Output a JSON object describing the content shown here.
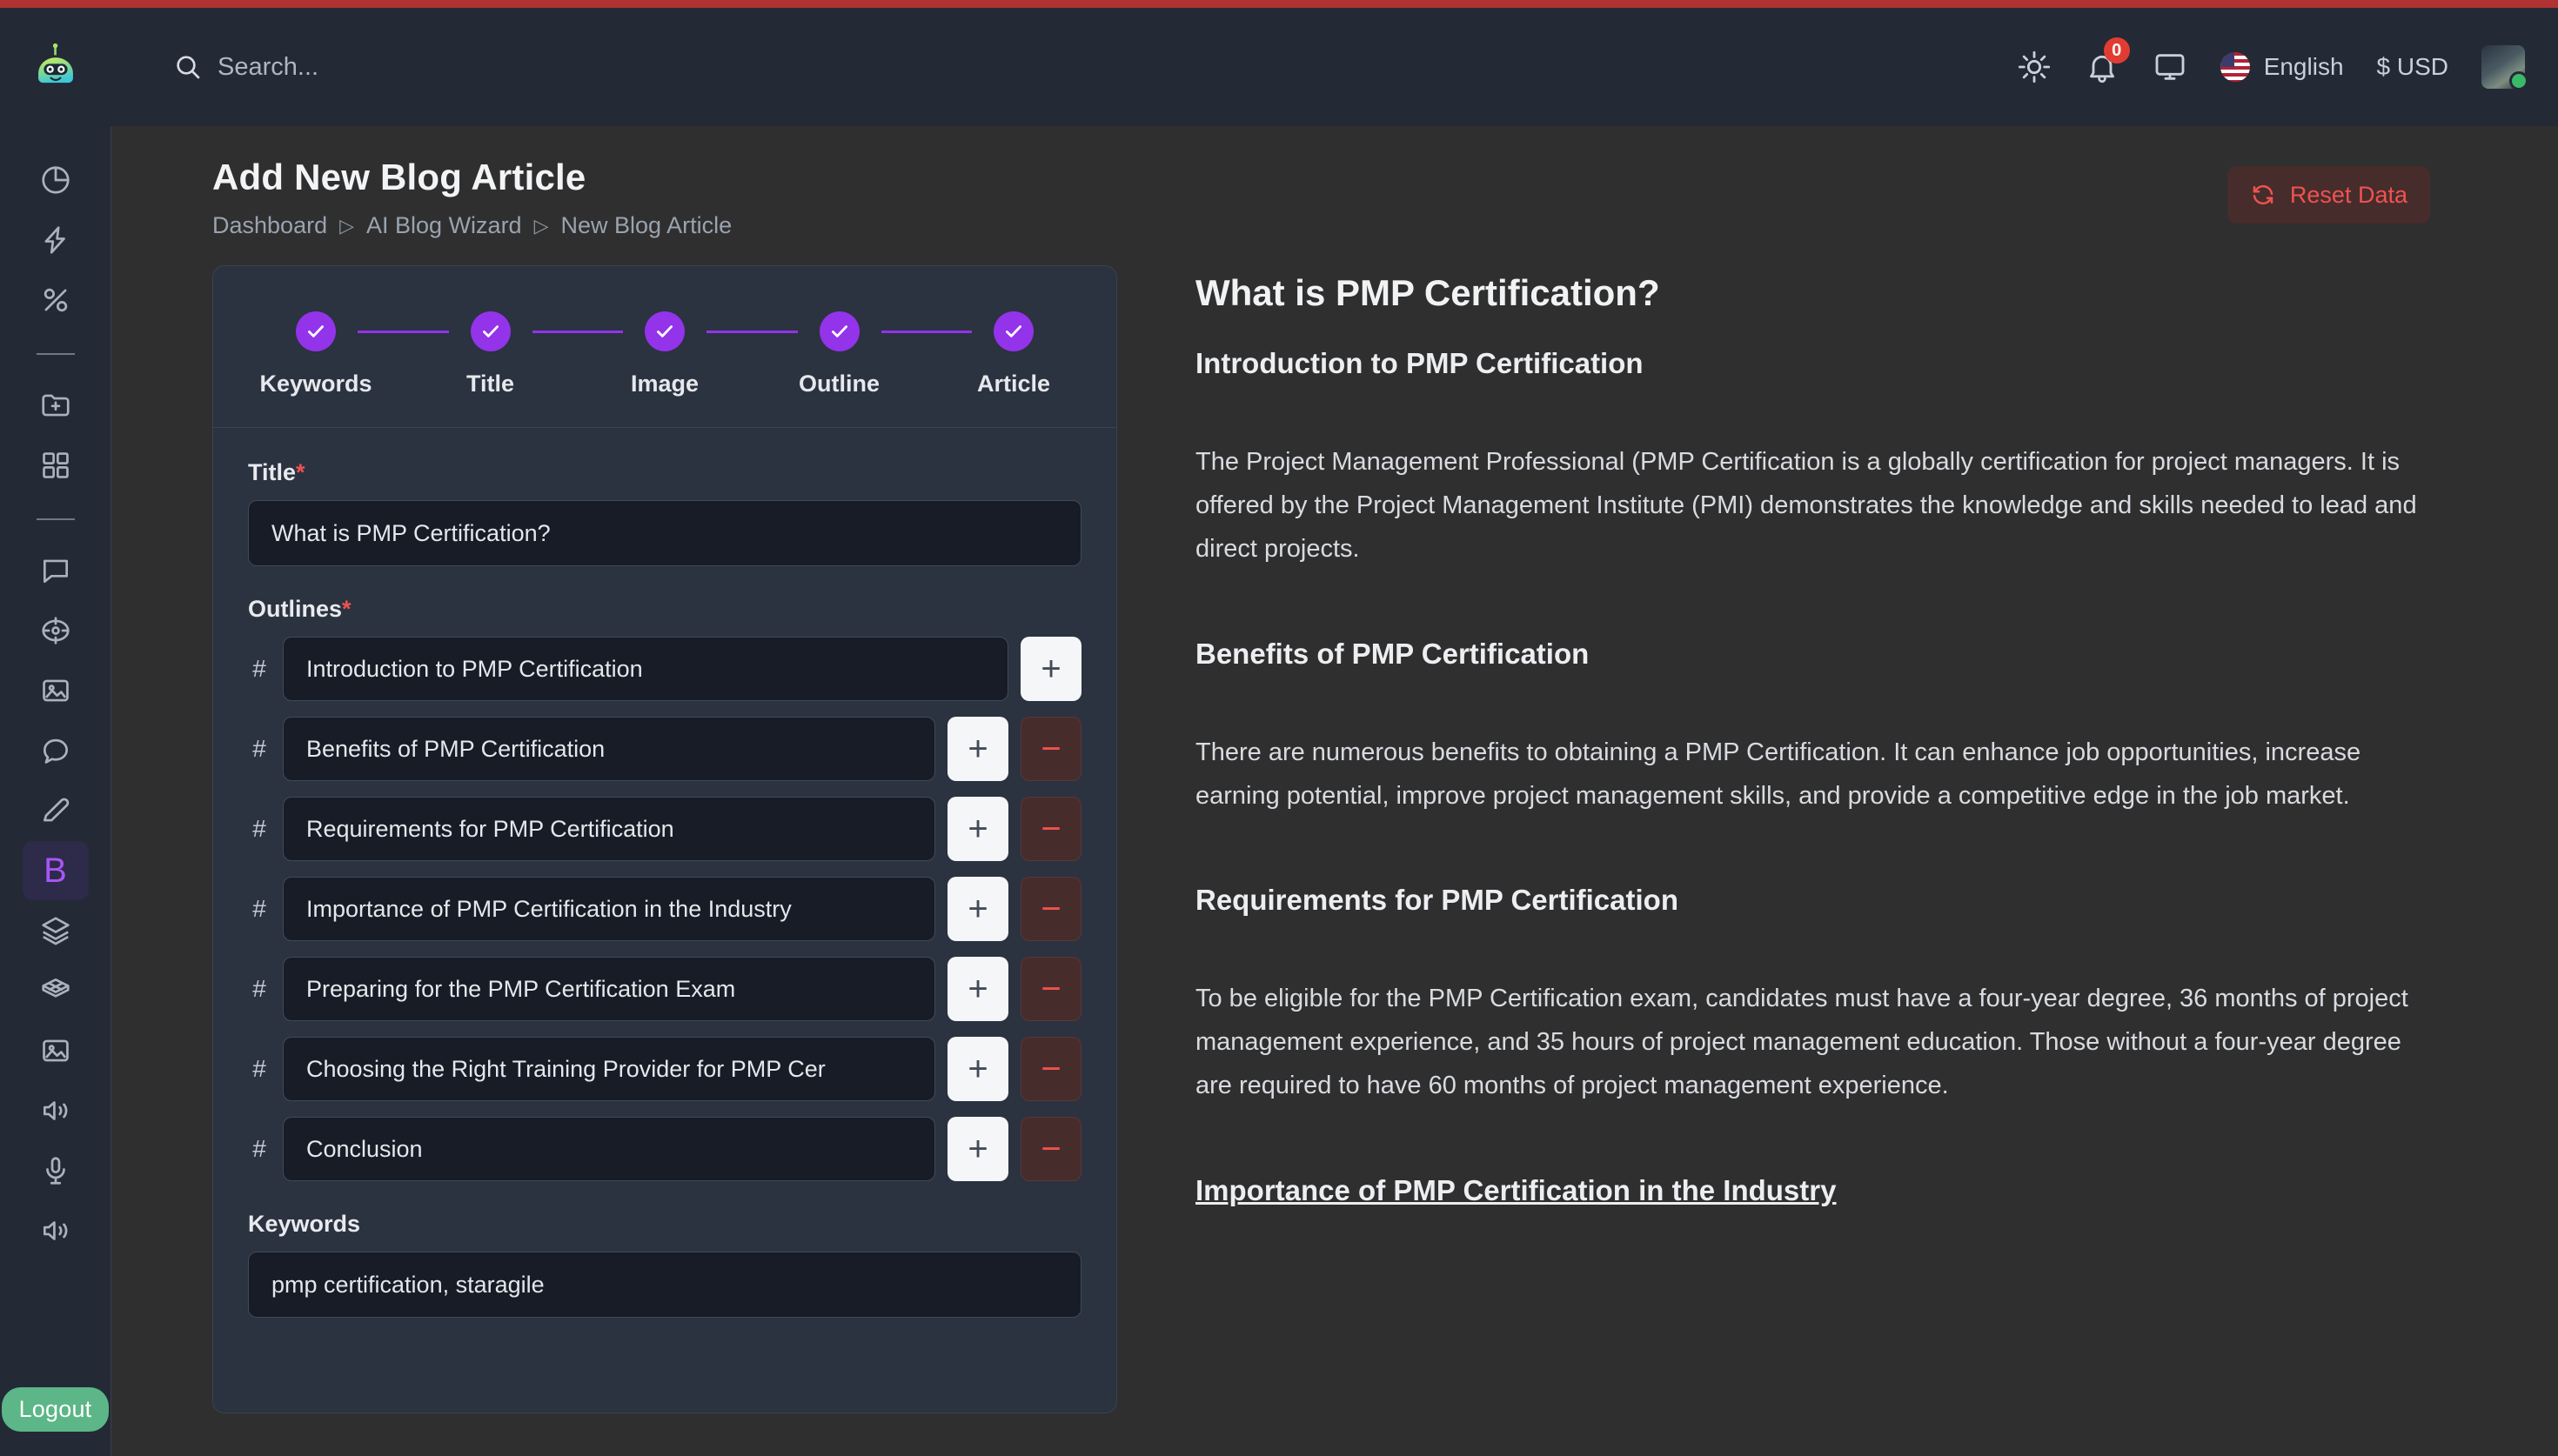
{
  "header": {
    "search_placeholder": "Search...",
    "notifications_count": "0",
    "language": "English",
    "currency": "$ USD",
    "icons": [
      "sun-icon",
      "bell-icon",
      "monitor-icon",
      "us-flag-icon",
      "avatar"
    ]
  },
  "sidebar": {
    "items": [
      {
        "icon": "pie-chart-icon",
        "name": "analytics"
      },
      {
        "icon": "lightning-icon",
        "name": "activity"
      },
      {
        "icon": "percent-icon",
        "name": "discounts"
      },
      {
        "icon": "divider",
        "name": "divider-1"
      },
      {
        "icon": "folder-plus-icon",
        "name": "new-folder"
      },
      {
        "icon": "grid-icon",
        "name": "apps"
      },
      {
        "icon": "divider",
        "name": "divider-2"
      },
      {
        "icon": "chat-square-icon",
        "name": "chat"
      },
      {
        "icon": "target-icon",
        "name": "target"
      },
      {
        "icon": "image-icon",
        "name": "images"
      },
      {
        "icon": "message-icon",
        "name": "messages"
      },
      {
        "icon": "pen-icon",
        "name": "writer"
      },
      {
        "icon": "b-letter-icon",
        "name": "blog-wizard",
        "label": "B",
        "active": true
      },
      {
        "icon": "layers-icon",
        "name": "layers"
      },
      {
        "icon": "box-3d-icon",
        "name": "3d-models"
      },
      {
        "icon": "image-icon",
        "name": "image-tools"
      },
      {
        "icon": "speaker-icon",
        "name": "text-to-speech"
      },
      {
        "icon": "microphone-icon",
        "name": "voice"
      },
      {
        "icon": "speaker-icon",
        "name": "audio"
      }
    ],
    "logout_label": "Logout"
  },
  "page": {
    "title": "Add New Blog Article",
    "breadcrumbs": [
      "Dashboard",
      "AI Blog Wizard",
      "New Blog Article"
    ],
    "breadcrumb_separator": "▷",
    "reset_button": "Reset Data"
  },
  "wizard": {
    "steps": [
      {
        "label": "Keywords",
        "completed": true
      },
      {
        "label": "Title",
        "completed": true
      },
      {
        "label": "Image",
        "completed": true
      },
      {
        "label": "Outline",
        "completed": true
      },
      {
        "label": "Article",
        "completed": true
      }
    ]
  },
  "form": {
    "title_label": "Title",
    "title_required": "*",
    "title_value": "What is PMP Certification?",
    "outlines_label": "Outlines",
    "outlines_required": "*",
    "hash_symbol": "#",
    "add_symbol": "+",
    "remove_symbol": "−",
    "outlines": [
      {
        "value": "Introduction to PMP Certification",
        "removable": false
      },
      {
        "value": "Benefits of PMP Certification",
        "removable": true
      },
      {
        "value": "Requirements for PMP Certification",
        "removable": true
      },
      {
        "value": "Importance of PMP Certification in the Industry",
        "removable": true
      },
      {
        "value": "Preparing for the PMP Certification Exam",
        "removable": true
      },
      {
        "value": "Choosing the Right Training Provider for PMP Cer",
        "removable": true
      },
      {
        "value": "Conclusion",
        "removable": true
      }
    ],
    "keywords_label": "Keywords",
    "keywords_value": "pmp certification, staragile"
  },
  "preview": {
    "article_title": "What is PMP Certification?",
    "blocks": [
      {
        "heading": "Introduction to PMP Certification",
        "underline": false,
        "paragraph": "The Project Management Professional (PMP Certification is a globally certification for project managers. It is offered by the Project Management Institute (PMI) demonstrates the knowledge and skills needed to lead and direct projects."
      },
      {
        "heading": "Benefits of PMP Certification",
        "underline": false,
        "paragraph": "There are numerous benefits to obtaining a PMP Certification. It can enhance job opportunities, increase earning potential, improve project management skills, and provide a competitive edge in the job market."
      },
      {
        "heading": "Requirements for PMP Certification",
        "underline": false,
        "paragraph": "To be eligible for the PMP Certification exam, candidates must have a four-year degree, 36 months of project management experience, and 35 hours of project management education. Those without a four-year degree are required to have 60 months of project management experience."
      },
      {
        "heading": "Importance of PMP Certification in the Industry",
        "underline": true,
        "paragraph": ""
      }
    ]
  },
  "colors": {
    "accent_purple": "#9333ea",
    "danger_red": "#ef5350",
    "success_green": "#5cb687",
    "top_strip": "#b03232",
    "header_bg": "#232a35",
    "card_bg": "#2b3240",
    "main_bg": "#2f2f2f"
  }
}
